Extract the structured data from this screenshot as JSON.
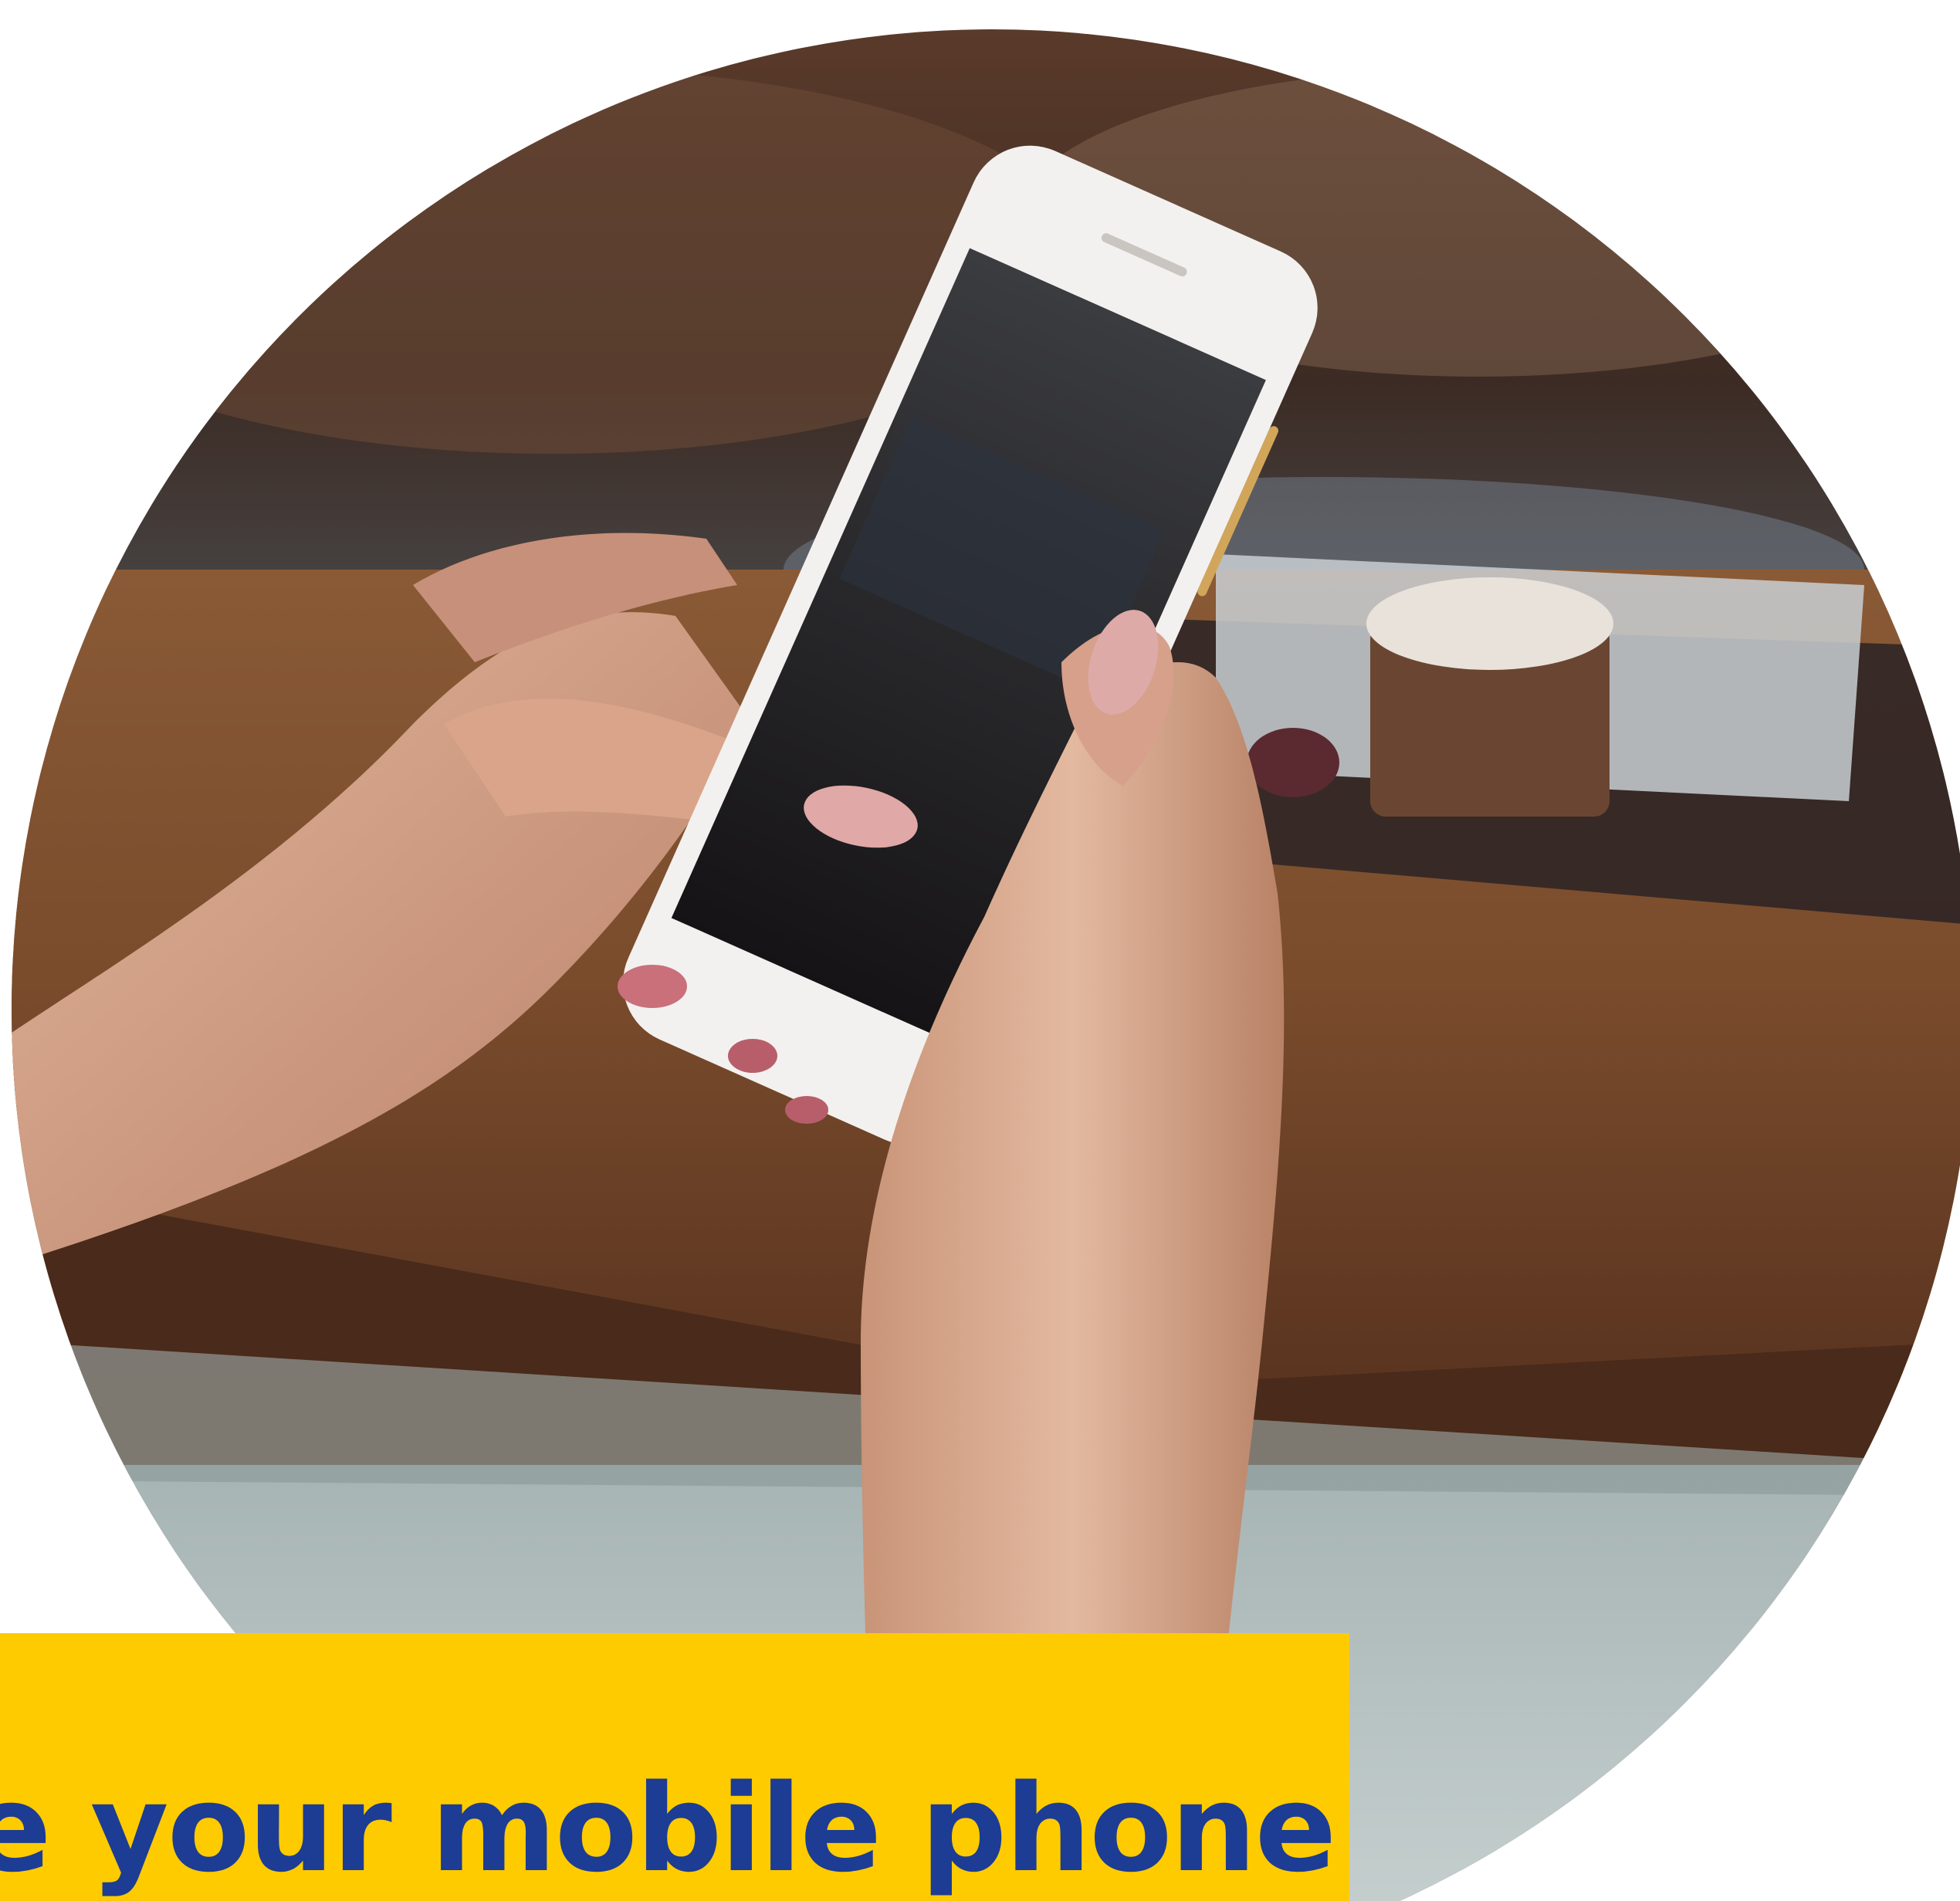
{
  "photo": {
    "subject": "hands-holding-smartphone",
    "colors": {
      "table": "#7a4a2a",
      "background_dark": "#3a2a22",
      "floor": "#b9c6c6",
      "skin": "#d9a88a",
      "phone_body": "#f2f0ee",
      "phone_screen": "#1f1c1e",
      "nail": "#c9707a"
    }
  },
  "caption": {
    "text": "se your mobile phone",
    "background_color": "#fecb00",
    "text_color": "#1d3c93"
  }
}
